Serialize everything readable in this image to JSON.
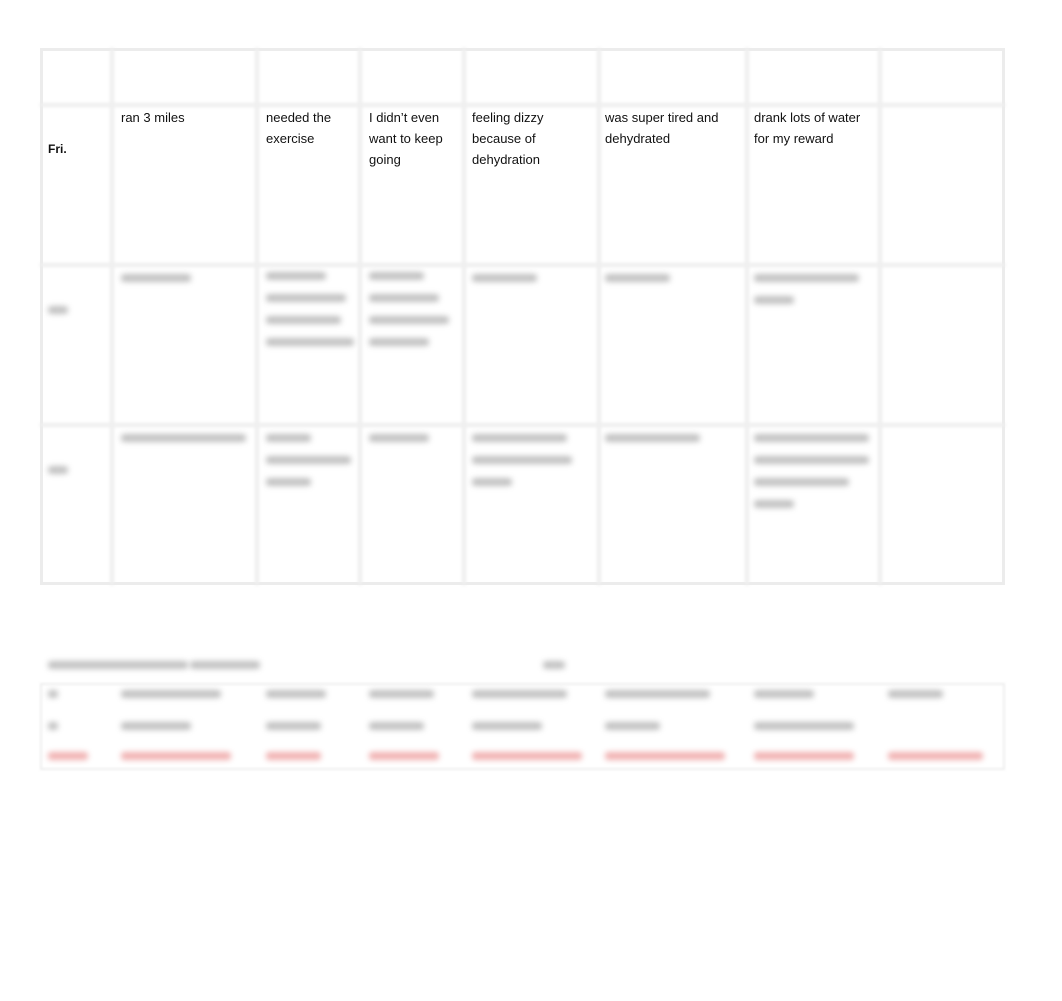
{
  "table": {
    "rows": [
      {
        "day": "Fri.",
        "cells": [
          "ran 3 miles",
          "needed the\nexercise",
          "I didn’t even\nwant to keep\ngoing",
          "feeling dizzy\nbecause of\ndehydration",
          "was super tired and\ndehydrated",
          "drank lots of water\nfor my reward",
          ""
        ]
      }
    ]
  },
  "colors": {
    "highlight_row": "#e57373",
    "grid": "#eeeeee"
  }
}
